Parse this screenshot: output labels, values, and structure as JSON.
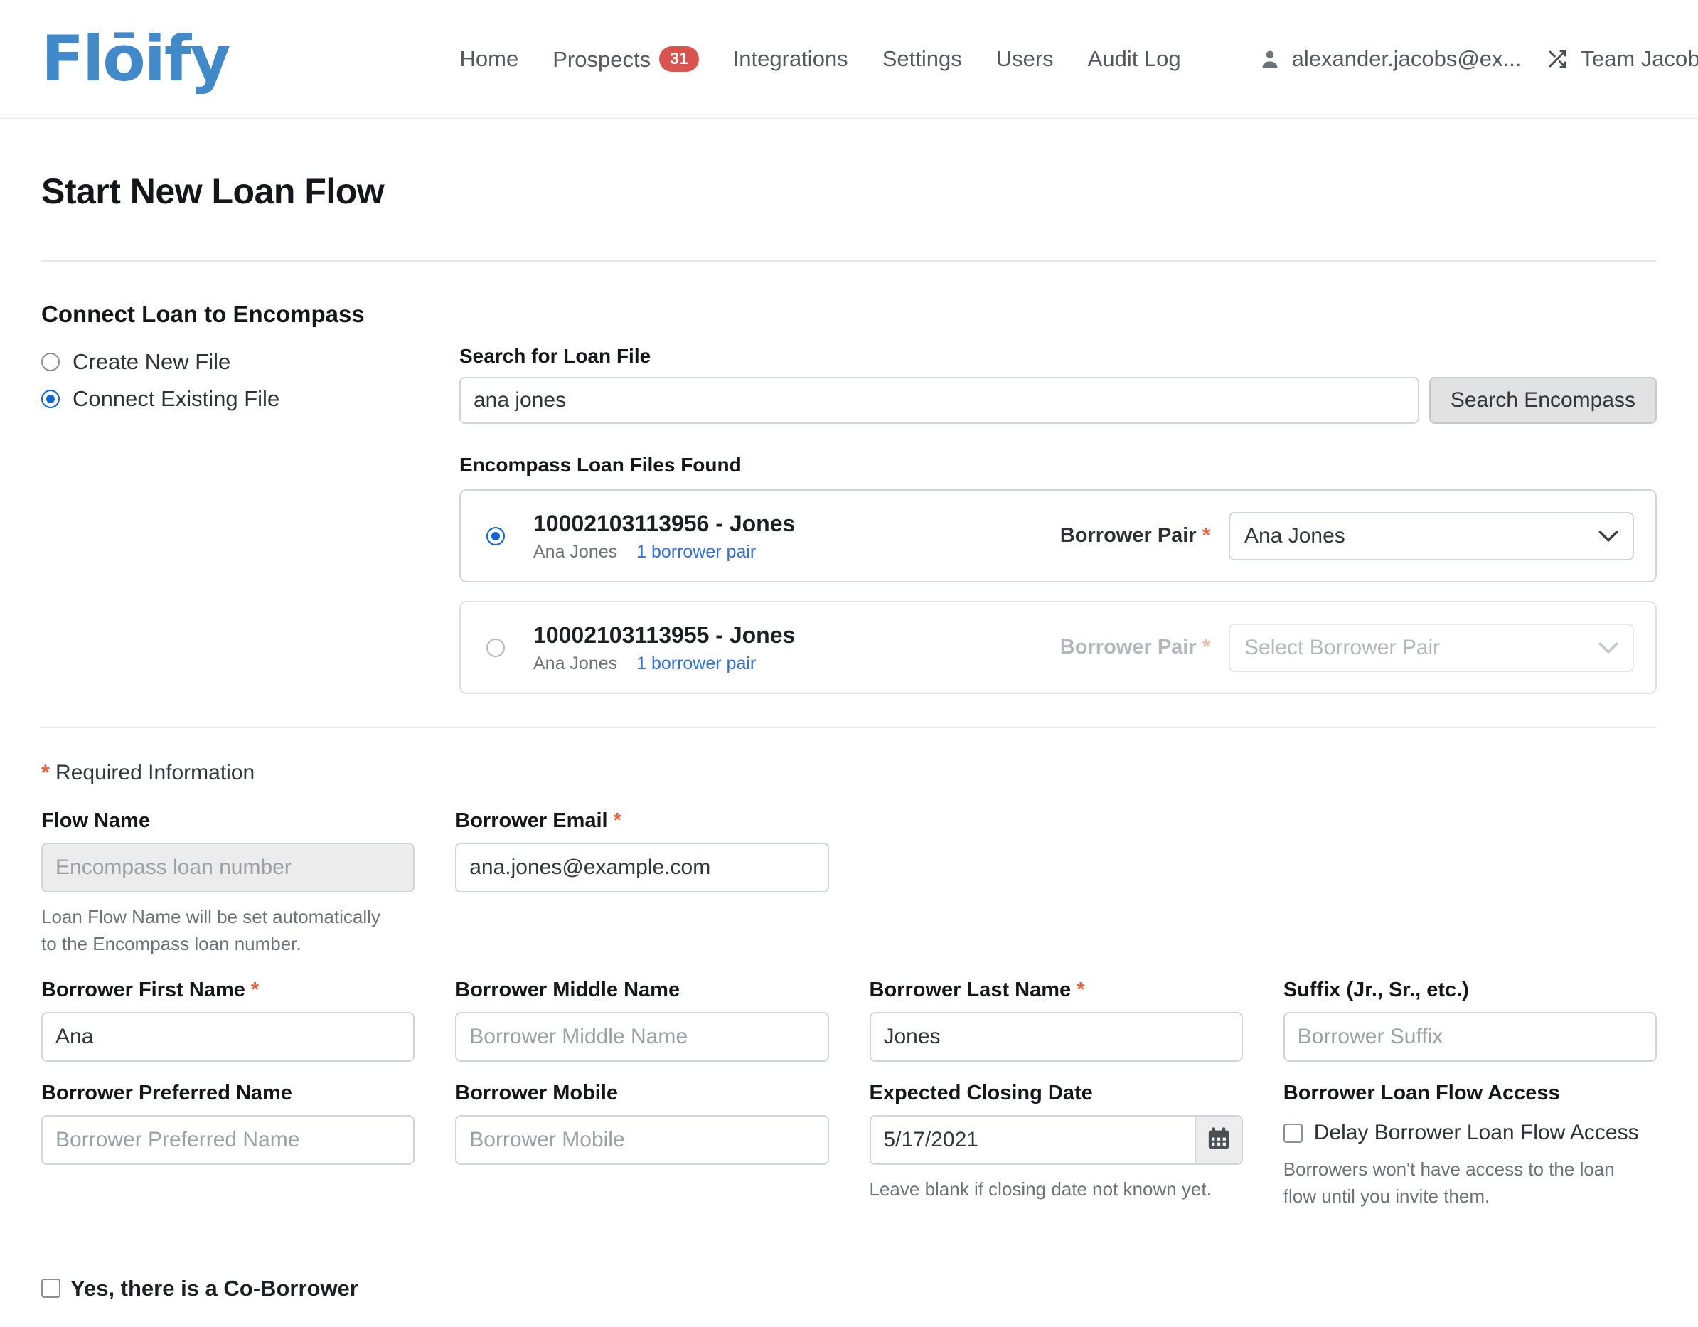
{
  "nav": {
    "brand": "Flōify",
    "links": [
      {
        "label": "Home",
        "name": "home"
      },
      {
        "label": "Prospects",
        "name": "prospects",
        "badge": "31"
      },
      {
        "label": "Integrations",
        "name": "integrations"
      },
      {
        "label": "Settings",
        "name": "settings"
      },
      {
        "label": "Users",
        "name": "users"
      },
      {
        "label": "Audit Log",
        "name": "audit-log"
      }
    ],
    "user_email": "alexander.jacobs@ex...",
    "team_name": "Team Jacobs",
    "icons": {
      "user": "user-icon",
      "switch": "shuffle-icon",
      "logout": "logout-icon"
    },
    "badge_color": "#d9534f",
    "brand_color": "#4189c8"
  },
  "page": {
    "title": "Start New Loan Flow"
  },
  "connect": {
    "section_title": "Connect Loan to Encompass",
    "options": [
      {
        "label": "Create New File",
        "selected": false
      },
      {
        "label": "Connect Existing File",
        "selected": true
      }
    ],
    "search": {
      "label": "Search for Loan File",
      "value": "ana jones",
      "placeholder": "Search for Loan File",
      "button": "Search Encompass"
    },
    "results_title": "Encompass Loan Files Found",
    "results": [
      {
        "selected": true,
        "name": "10002103113956 - Jones",
        "borrower": "Ana Jones",
        "pairs_link": "1 borrower pair",
        "pair_label": "Borrower Pair",
        "pair_required": "*",
        "pair_value": "Ana Jones",
        "disabled": false
      },
      {
        "selected": false,
        "name": "10002103113955 - Jones",
        "borrower": "Ana Jones",
        "pairs_link": "1 borrower pair",
        "pair_label": "Borrower Pair",
        "pair_required": "*",
        "pair_value": "Select Borrower Pair",
        "disabled": true
      }
    ]
  },
  "form": {
    "required_note_star": "*",
    "required_note": "Required Information",
    "flow_name": {
      "label": "Flow Name",
      "value": "",
      "placeholder": "Encompass loan number",
      "help": "Loan Flow Name will be set automatically to the Encompass loan number."
    },
    "borrower_email": {
      "label": "Borrower Email",
      "required": "*",
      "value": "ana.jones@example.com",
      "placeholder": "Borrower Email"
    },
    "first_name": {
      "label": "Borrower First Name",
      "required": "*",
      "value": "Ana",
      "placeholder": "Borrower First Name"
    },
    "middle_name": {
      "label": "Borrower Middle Name",
      "value": "",
      "placeholder": "Borrower Middle Name"
    },
    "last_name": {
      "label": "Borrower Last Name",
      "required": "*",
      "value": "Jones",
      "placeholder": "Borrower Last Name"
    },
    "suffix": {
      "label": "Suffix (Jr., Sr., etc.)",
      "value": "",
      "placeholder": "Borrower Suffix"
    },
    "preferred_name": {
      "label": "Borrower Preferred Name",
      "value": "",
      "placeholder": "Borrower Preferred Name"
    },
    "mobile": {
      "label": "Borrower Mobile",
      "value": "",
      "placeholder": "Borrower Mobile"
    },
    "closing_date": {
      "label": "Expected Closing Date",
      "value": "5/17/2021",
      "placeholder": "Expected Closing Date",
      "help": "Leave blank if closing date not known yet.",
      "icon": "calendar-icon"
    },
    "loan_flow_access": {
      "label": "Borrower Loan Flow Access",
      "checkbox_label": "Delay Borrower Loan Flow Access",
      "checked": false,
      "help": "Borrowers won't have access to the loan flow until you invite them."
    },
    "coborrower": {
      "label": "Yes, there is a Co-Borrower",
      "checked": false
    }
  }
}
